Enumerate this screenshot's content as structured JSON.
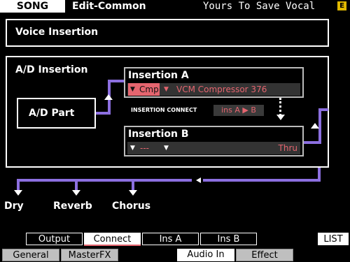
{
  "header": {
    "mode": "SONG",
    "screen": "Edit-Common",
    "title": "Yours To Save Vocal",
    "icon": "E"
  },
  "voice_insertion": {
    "label": "Voice Insertion"
  },
  "ad_insertion": {
    "label": "A/D Insertion",
    "part_label": "A/D Part"
  },
  "insertion_a": {
    "title": "Insertion A",
    "category": "Cmp",
    "effect": "VCM Compressor 376"
  },
  "insertion_connect": {
    "label": "INSERTION CONNECT",
    "value": "ins A ▶ B"
  },
  "insertion_b": {
    "title": "Insertion B",
    "category": "---",
    "effect": "Thru"
  },
  "outputs": [
    "Dry",
    "Reverb",
    "Chorus"
  ],
  "tabs": [
    {
      "label": "Output",
      "active": false
    },
    {
      "label": "Connect",
      "active": true
    },
    {
      "label": "Ins A",
      "active": false
    },
    {
      "label": "Ins B",
      "active": false
    }
  ],
  "list_button": "LIST",
  "bottom_tabs": [
    {
      "label": "General",
      "active": false
    },
    {
      "label": "MasterFX",
      "active": false
    },
    {
      "label": "Audio In",
      "active": true
    },
    {
      "label": "Effect",
      "active": false
    }
  ],
  "colors": {
    "accent": "#8c6fe0",
    "select": "#e5656f",
    "icon": "#e0b800"
  }
}
